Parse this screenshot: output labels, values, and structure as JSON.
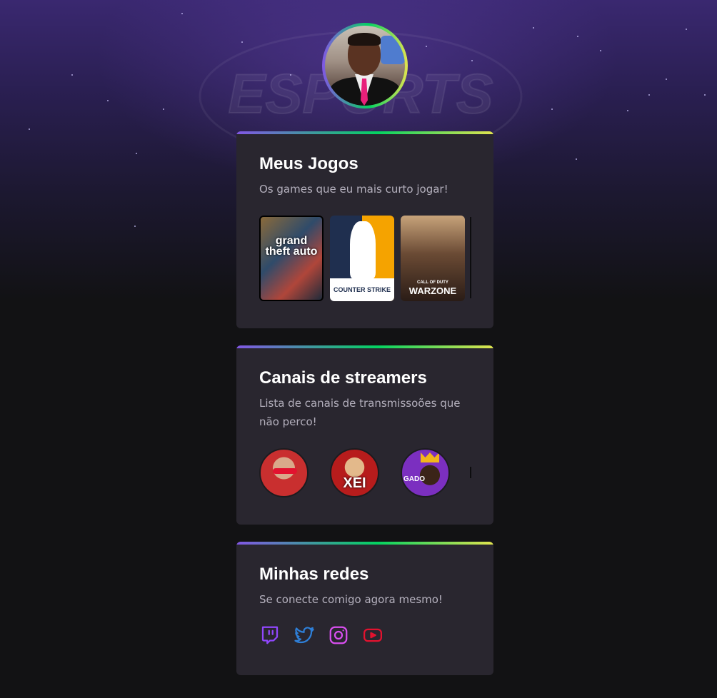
{
  "profile": {
    "avatar_alt": "Foto de perfil"
  },
  "background": {
    "watermark_text": "ESPORTS"
  },
  "games_card": {
    "title": "Meus Jogos",
    "subtitle": "Os games que eu mais curto jogar!",
    "games": [
      {
        "name": "grand theft auto V",
        "cover_text": "grand theft auto"
      },
      {
        "name": "Counter Strike",
        "cover_text": "COUNTER STRIKE"
      },
      {
        "name": "Call of Duty Warzone",
        "cover_sub": "CALL OF DUTY",
        "cover_text": "WARZONE"
      }
    ]
  },
  "streamers_card": {
    "title": "Canais de streamers",
    "subtitle": "Lista de canais de transmissoões que não perco!",
    "streamers": [
      {
        "name": "streamer-1"
      },
      {
        "name": "streamer-2",
        "badge": "XEI"
      },
      {
        "name": "streamer-3",
        "badge": "GADO"
      }
    ]
  },
  "socials_card": {
    "title": "Minhas redes",
    "subtitle": "Se conecte comigo agora mesmo!",
    "links": [
      {
        "icon": "twitch-icon",
        "color": "#9147ff"
      },
      {
        "icon": "twitter-icon",
        "color": "#2e7fd8"
      },
      {
        "icon": "instagram-icon",
        "color": "#d94ff0"
      },
      {
        "icon": "youtube-icon",
        "color": "#e3122f"
      }
    ]
  },
  "colors": {
    "page_bg": "#121214",
    "card_bg": "#29262f",
    "gradient": [
      "#8257e5",
      "#04d361",
      "#e1e44f"
    ]
  }
}
